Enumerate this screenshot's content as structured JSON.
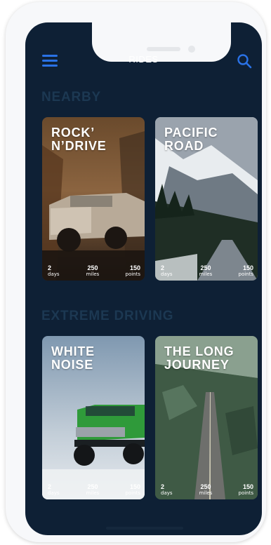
{
  "header": {
    "title": "RIDES",
    "menu_icon": "hamburger-menu-icon",
    "search_icon": "search-icon",
    "accent_color": "#2a72e6"
  },
  "sections": [
    {
      "title": "NEARBY",
      "cards": [
        {
          "title": "ROCK’\nN’DRIVE",
          "stats": [
            {
              "value": "2",
              "unit": "days"
            },
            {
              "value": "250",
              "unit": "miles"
            },
            {
              "value": "150",
              "unit": "points"
            }
          ]
        },
        {
          "title": "PACIFIC\nROAD",
          "stats": [
            {
              "value": "2",
              "unit": "days"
            },
            {
              "value": "250",
              "unit": "miles"
            },
            {
              "value": "150",
              "unit": "points"
            }
          ]
        }
      ]
    },
    {
      "title": "EXTREME DRIVING",
      "cards": [
        {
          "title": "WHITE\nNOISE",
          "stats": [
            {
              "value": "2",
              "unit": "days"
            },
            {
              "value": "250",
              "unit": "miles"
            },
            {
              "value": "150",
              "unit": "points"
            }
          ]
        },
        {
          "title": "THE LONG\nJOURNEY",
          "stats": [
            {
              "value": "2",
              "unit": "days"
            },
            {
              "value": "250",
              "unit": "miles"
            },
            {
              "value": "150",
              "unit": "points"
            }
          ]
        }
      ]
    }
  ],
  "colors": {
    "screen_background": "#0e2035",
    "section_title": "#1c3852"
  }
}
